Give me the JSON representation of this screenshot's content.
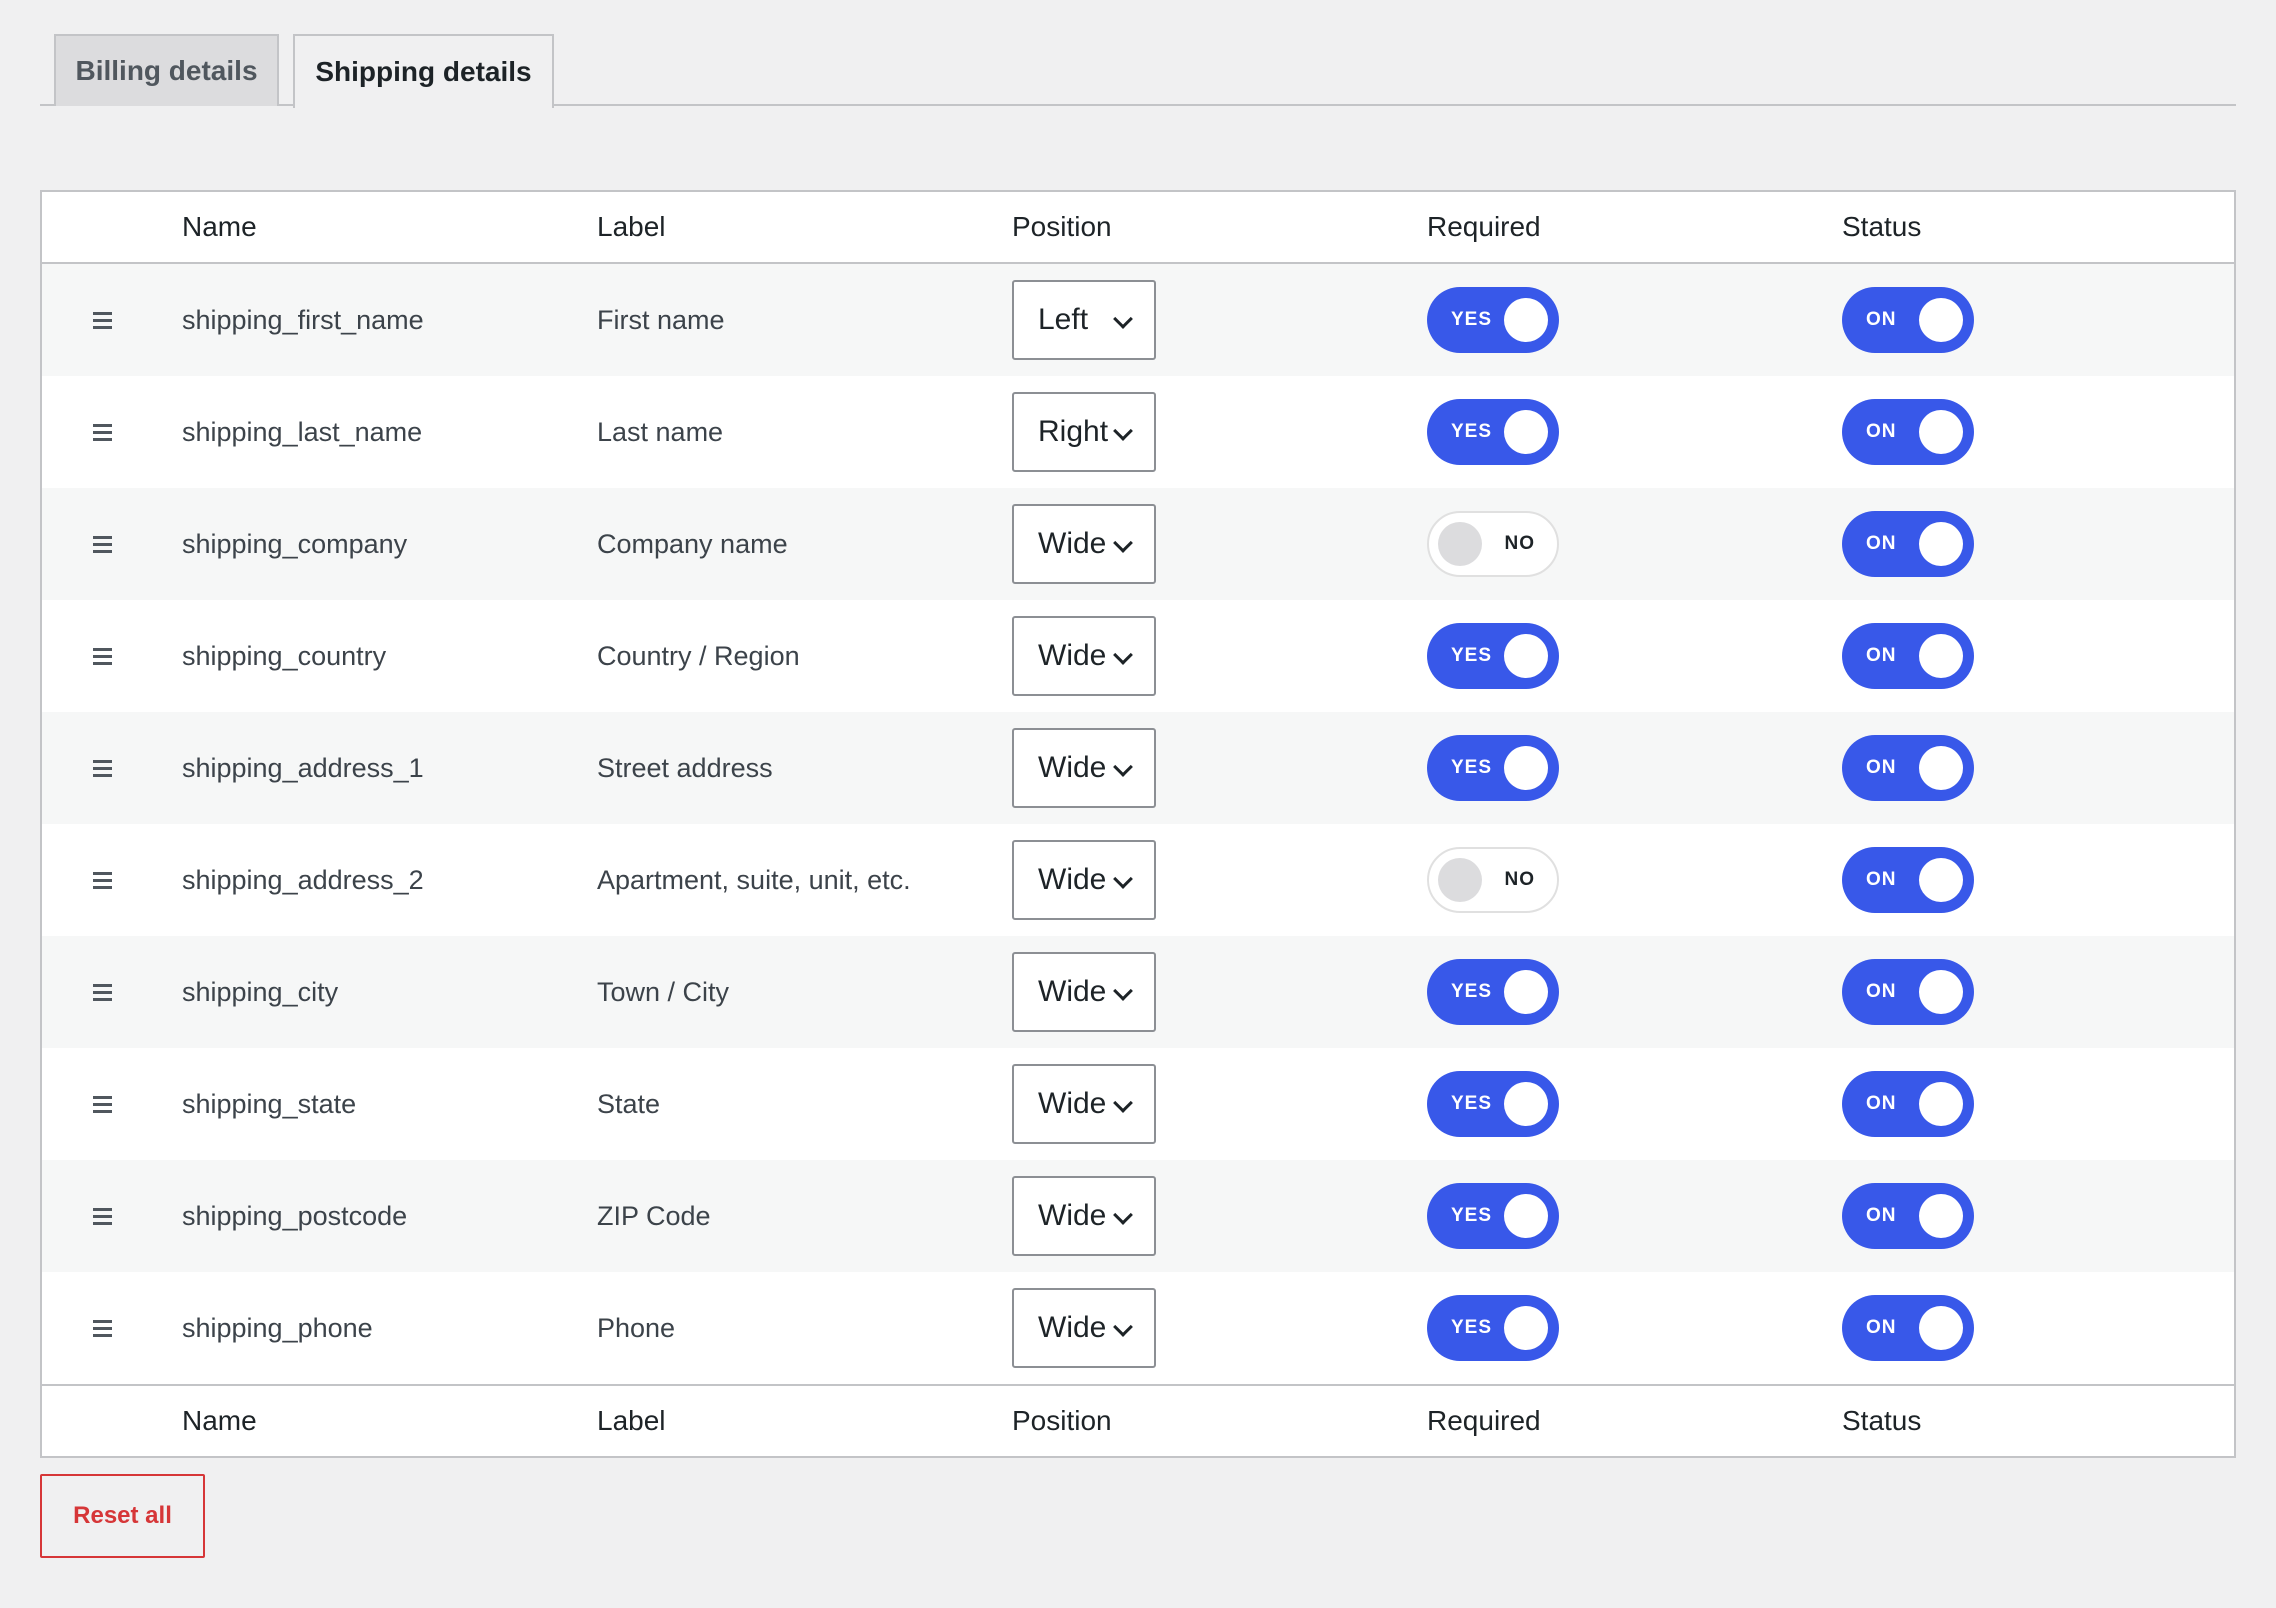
{
  "tabs": [
    {
      "label": "Billing details",
      "active": false
    },
    {
      "label": "Shipping details",
      "active": true
    }
  ],
  "columns": {
    "name": "Name",
    "label": "Label",
    "position": "Position",
    "required": "Required",
    "status": "Status"
  },
  "rows": [
    {
      "name": "shipping_first_name",
      "label": "First name",
      "position": "Left",
      "required": "YES",
      "status": "ON"
    },
    {
      "name": "shipping_last_name",
      "label": "Last name",
      "position": "Right",
      "required": "YES",
      "status": "ON"
    },
    {
      "name": "shipping_company",
      "label": "Company name",
      "position": "Wide",
      "required": "NO",
      "status": "ON"
    },
    {
      "name": "shipping_country",
      "label": "Country / Region",
      "position": "Wide",
      "required": "YES",
      "status": "ON"
    },
    {
      "name": "shipping_address_1",
      "label": "Street address",
      "position": "Wide",
      "required": "YES",
      "status": "ON"
    },
    {
      "name": "shipping_address_2",
      "label": "Apartment, suite, unit, etc.",
      "position": "Wide",
      "required": "NO",
      "status": "ON"
    },
    {
      "name": "shipping_city",
      "label": "Town / City",
      "position": "Wide",
      "required": "YES",
      "status": "ON"
    },
    {
      "name": "shipping_state",
      "label": "State",
      "position": "Wide",
      "required": "YES",
      "status": "ON"
    },
    {
      "name": "shipping_postcode",
      "label": "ZIP Code",
      "position": "Wide",
      "required": "YES",
      "status": "ON"
    },
    {
      "name": "shipping_phone",
      "label": "Phone",
      "position": "Wide",
      "required": "YES",
      "status": "ON"
    }
  ],
  "reset_label": "Reset all",
  "colors": {
    "toggle_on": "#3858e9",
    "reset": "#d63638"
  }
}
